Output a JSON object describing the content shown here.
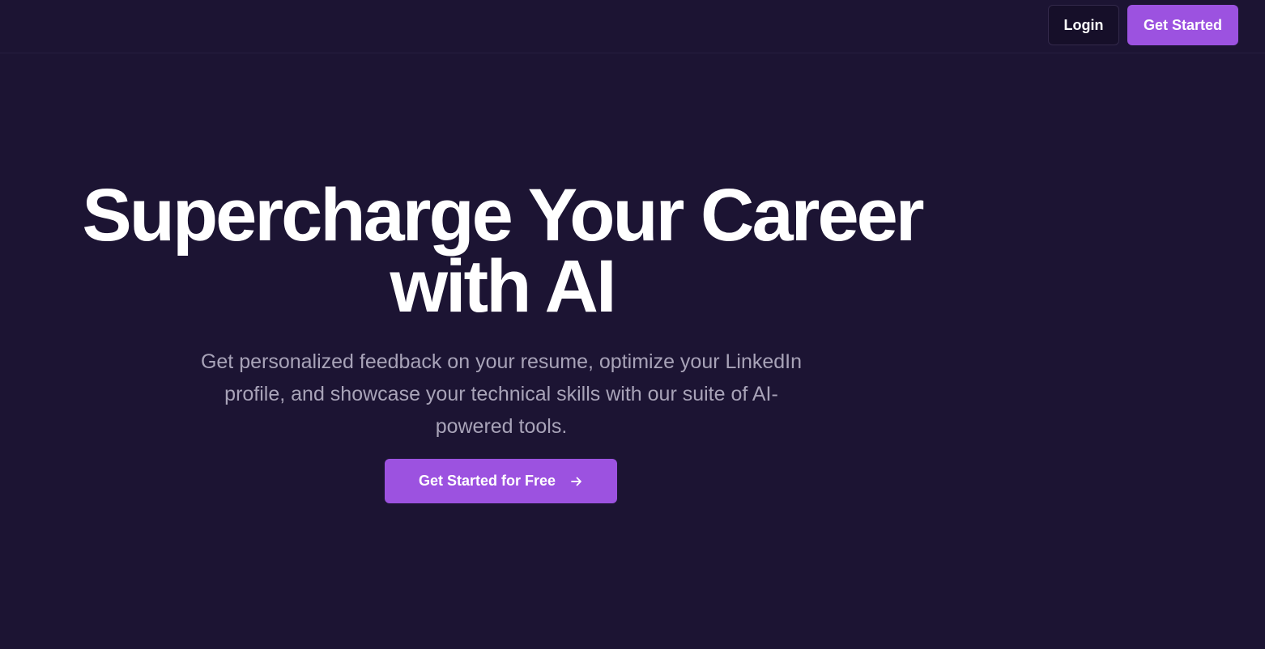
{
  "header": {
    "login_label": "Login",
    "get_started_label": "Get Started"
  },
  "hero": {
    "title_line1": "Supercharge Your Career",
    "title_line2": "with AI",
    "subtitle_line1": "Get personalized feedback on your resume, optimize your LinkedIn",
    "subtitle_line2": "profile, and showcase your technical skills with our suite of AI-",
    "subtitle_line3": "powered tools.",
    "cta_label": "Get Started for Free",
    "cta_icon": "arrow-right-icon"
  },
  "colors": {
    "background": "#1c1433",
    "accent": "#9c52e0",
    "text_primary": "#ffffff",
    "text_secondary": "#a8a3b8"
  }
}
